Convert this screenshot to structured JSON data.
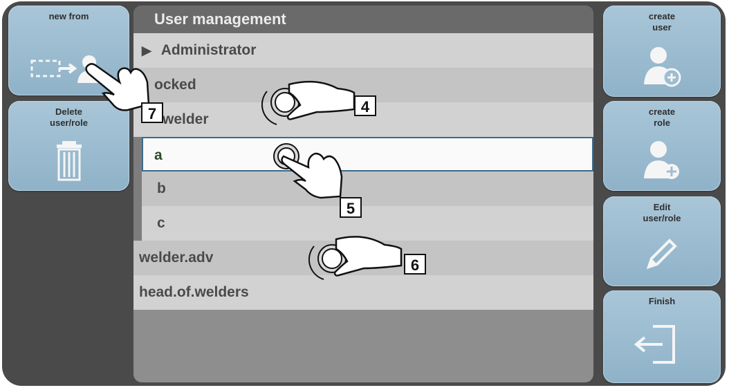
{
  "panel": {
    "title": "User management"
  },
  "left_buttons": [
    {
      "label": "new from"
    },
    {
      "label": "Delete\nuser/role"
    }
  ],
  "right_buttons": [
    {
      "label": "create\nuser"
    },
    {
      "label": "create\nrole"
    },
    {
      "label": "Edit\nuser/role"
    },
    {
      "label": "Finish"
    }
  ],
  "rows": [
    {
      "label": "Administrator",
      "expand_glyph": "▶"
    },
    {
      "label": "ocked"
    },
    {
      "label": "welder"
    },
    {
      "label": "a"
    },
    {
      "label": "b"
    },
    {
      "label": "c"
    },
    {
      "label": "welder.adv"
    },
    {
      "label": "head.of.welders"
    }
  ],
  "callouts": [
    "4",
    "5",
    "6",
    "7"
  ],
  "colors": {
    "button": "#9dbdd1",
    "frame": "#4a4a4a",
    "selected_border": "#3d6a8c"
  },
  "icons": [
    "copy-user-icon",
    "trash-icon",
    "user-add-icon",
    "role-add-icon",
    "pencil-icon",
    "exit-icon",
    "turn-dial-hand-icon",
    "press-hand-icon"
  ]
}
